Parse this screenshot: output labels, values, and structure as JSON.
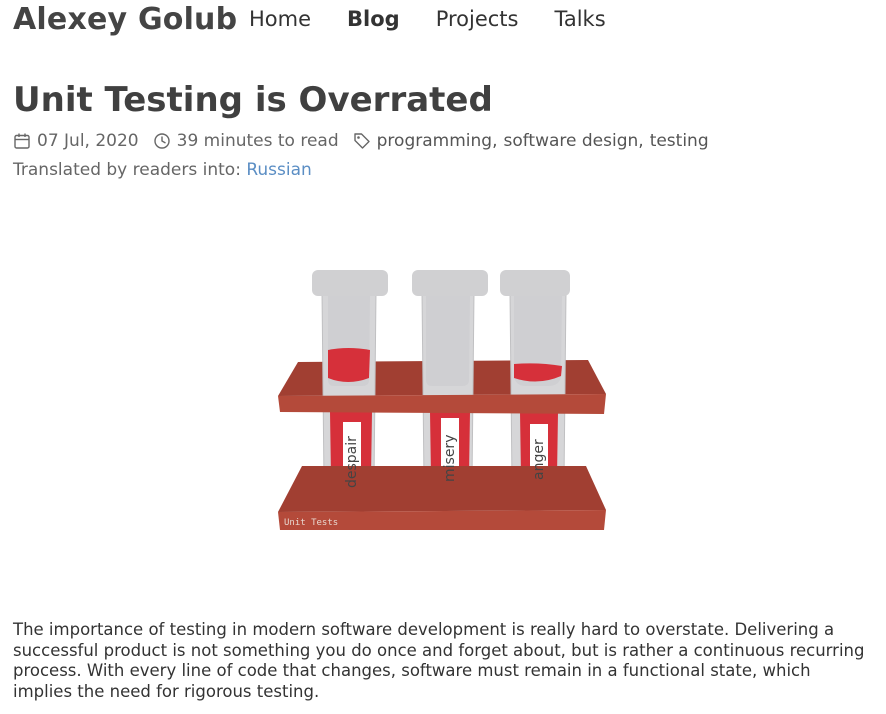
{
  "header": {
    "site_title": "Alexey Golub",
    "nav": [
      {
        "label": "Home",
        "active": false
      },
      {
        "label": "Blog",
        "active": true
      },
      {
        "label": "Projects",
        "active": false
      },
      {
        "label": "Talks",
        "active": false
      }
    ]
  },
  "post": {
    "title": "Unit Testing is Overrated",
    "date": "07 Jul, 2020",
    "reading_time": "39 minutes to read",
    "tags": [
      "programming",
      "software design",
      "testing"
    ],
    "tag_separator": ",",
    "translated_prefix": "Translated by readers into:",
    "translated_language": "Russian",
    "image": {
      "tube_labels": [
        "despair",
        "misery",
        "anger"
      ],
      "caption": "Unit Tests"
    },
    "intro": "The importance of testing in modern software development is really hard to overstate. Delivering a successful product is not something you do once and forget about, but is rather a continuous recurring process. With every line of code that changes, software must remain in a functional state, which implies the need for rigorous testing."
  },
  "colors": {
    "link": "#5b8ec4",
    "rack": "#b44a3a",
    "liquid": "#d6303a",
    "tube": "#d4d4d6"
  }
}
